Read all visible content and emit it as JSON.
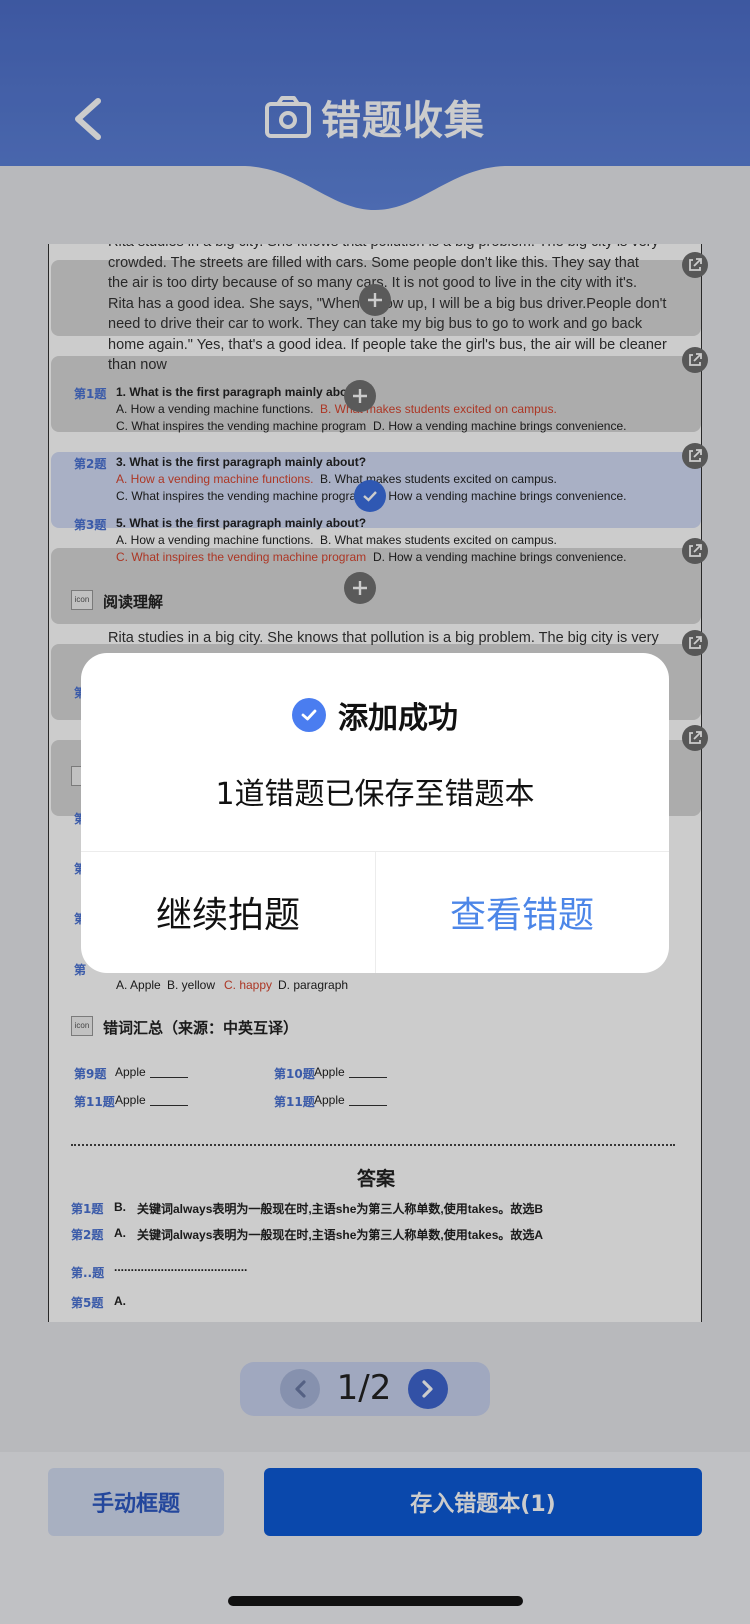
{
  "header": {
    "title": "错题收集"
  },
  "document": {
    "passage_top": [
      "Rita studies in a big city. She knows that pollution is a big problem. The big city is very",
      "crowded. The streets are filled with cars. Some people don't like this. They say that",
      "the air is too dirty because of so many cars. It is not good to live in the city with it's.",
      "Rita has a good idea. She says, \"When I grow up, I will be a big bus driver.People don't",
      "need to drive their car to work. They can take my big bus to go to work and go back",
      "home again.\" Yes, that's a good idea. If people take the girl's bus, the air will be cleaner",
      "than now"
    ],
    "q1": {
      "num": "第1题",
      "stem": "1. What is the first paragraph mainly about?",
      "a": "A. How a vending machine functions.",
      "b": "B. What makes students excited on campus.",
      "c": "C. What inspires the vending machine program",
      "d": "D. How a vending machine brings convenience."
    },
    "q2": {
      "num": "第2题",
      "stem": "3. What is the first paragraph mainly about?",
      "a": "A. How a vending machine functions.",
      "b": "B. What makes students excited on campus.",
      "c": "C. What inspires the vending machine program",
      "d": "D. How a vending machine brings convenience."
    },
    "q3": {
      "num": "第3题",
      "stem": "5. What is the first paragraph mainly about?",
      "a": "A. How a vending machine functions.",
      "b": "B. What makes students excited on campus.",
      "c": "C. What inspires the vending machine program",
      "d": "D. How a vending machine brings convenience."
    },
    "section_reading": {
      "icon_text": "icon",
      "title": "阅读理解"
    },
    "passage_reading_first_line": "Rita studies in a big city. She knows that pollution is a big problem. The big city is very",
    "hidden_fragments": [
      "第",
      "第",
      "第",
      "第",
      "第"
    ],
    "q8_options": {
      "a": "A. Apple",
      "b": "B. yellow",
      "c": "C. happy",
      "d": "D. paragraph"
    },
    "section_words": {
      "icon_text": "icon",
      "title": "错词汇总（来源：中英互译）"
    },
    "words": [
      {
        "num": "第9题",
        "word": "Apple"
      },
      {
        "num": "第10题",
        "word": "Apple"
      },
      {
        "num": "第11题",
        "word": "Apple"
      },
      {
        "num": "第11题",
        "word": "Apple"
      }
    ],
    "answers_title": "答案",
    "answers": [
      {
        "num": "第1题",
        "letter": "B.",
        "text": "关键词always表明为一般现在时,主语she为第三人称单数,使用takes。故选B"
      },
      {
        "num": "第2题",
        "letter": "A.",
        "text": "关键词always表明为一般现在时,主语she为第三人称单数,使用takes。故选A"
      },
      {
        "num": "第..题",
        "letter": "",
        "text": "........................................"
      },
      {
        "num": "第5题",
        "letter": "A.",
        "text": ""
      }
    ]
  },
  "pager": {
    "text": "1/2"
  },
  "bottom": {
    "manual_label": "手动框题",
    "save_label": "存入错题本(1)"
  },
  "dialog": {
    "title": "添加成功",
    "message": "1道错题已保存至错题本",
    "continue_label": "继续拍题",
    "view_label": "查看错题"
  },
  "colors": {
    "accent": "#4a7df0",
    "header": "#5b7fd6",
    "primary_button": "#0d5ad8",
    "highlight_red": "#d7452f",
    "question_blue": "#4a72d4"
  }
}
